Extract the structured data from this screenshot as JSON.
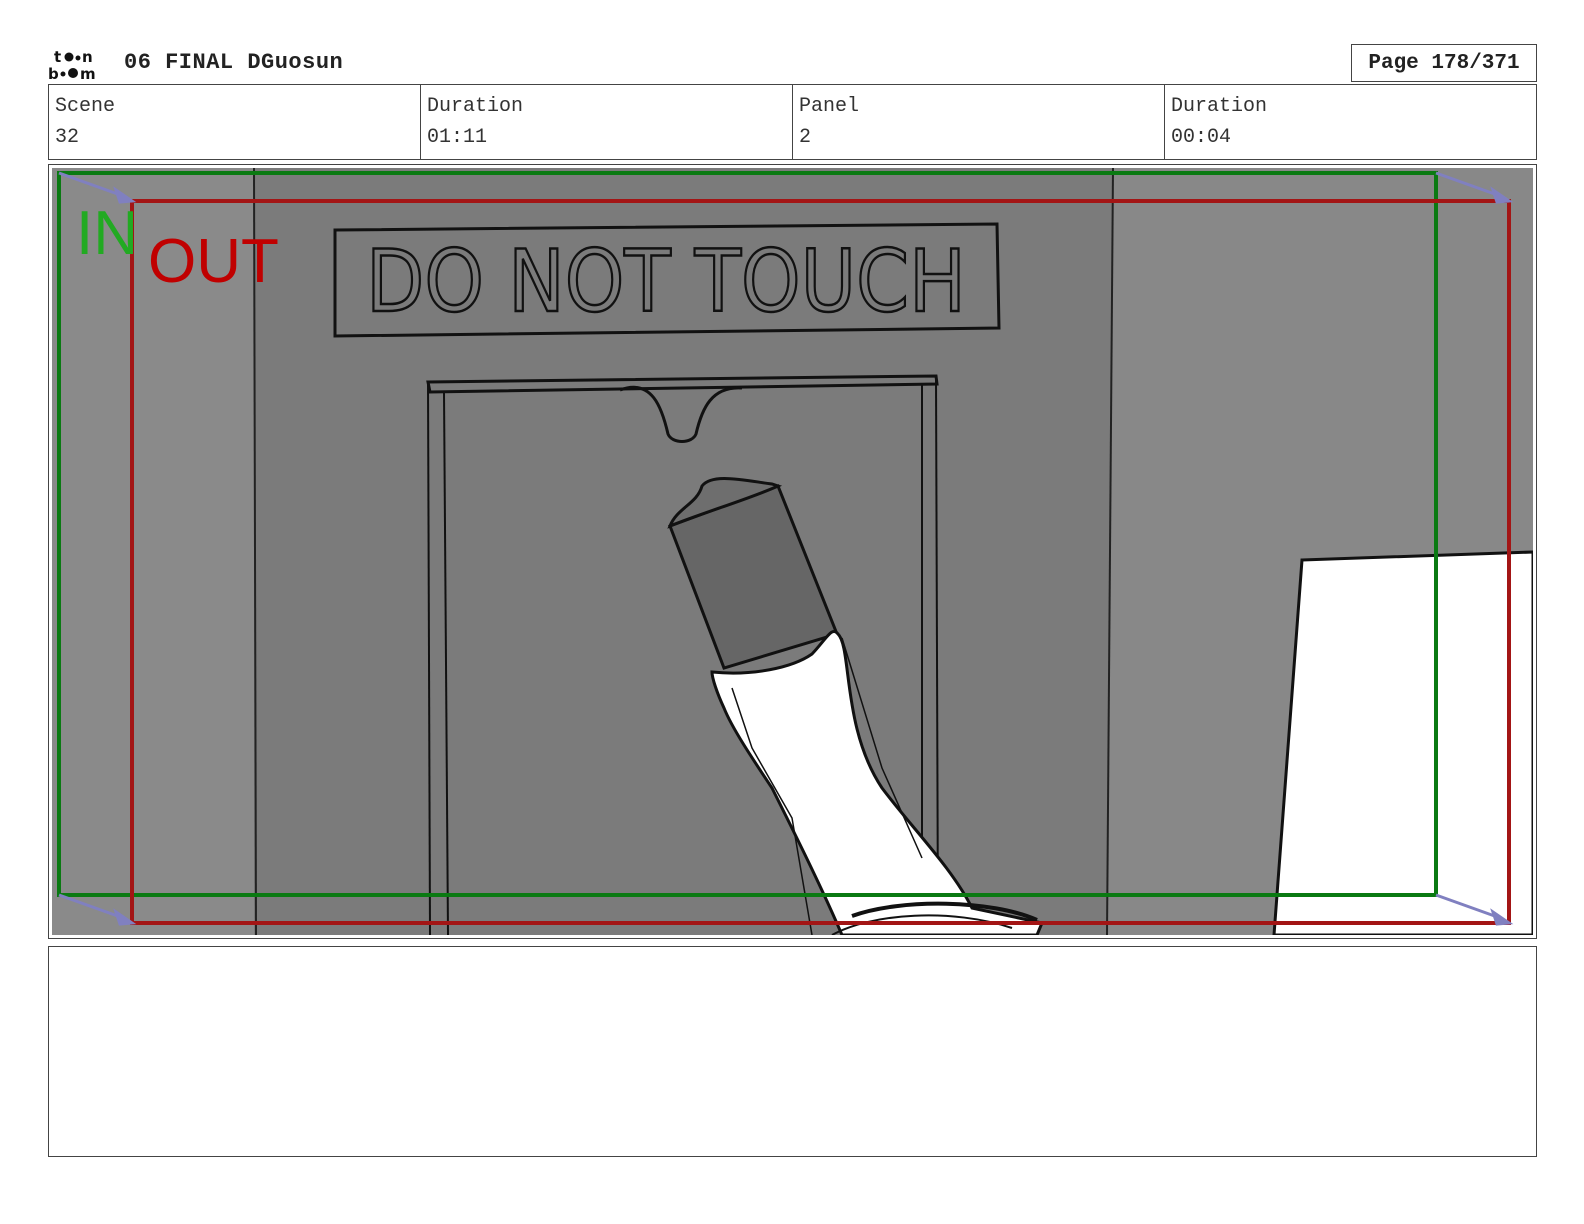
{
  "header": {
    "logo_text": "toon boom",
    "project_title": "06 FINAL DGuosun",
    "page_label": "Page 178/371"
  },
  "info": [
    {
      "label": "Scene",
      "value": "32"
    },
    {
      "label": "Duration",
      "value": "01:11"
    },
    {
      "label": "Panel",
      "value": "2"
    },
    {
      "label": "Duration",
      "value": "00:04"
    }
  ],
  "panel": {
    "sign_text": "DO NOT TOUCH",
    "in_label": "IN",
    "out_label": "OUT",
    "colors": {
      "in_frame": "#0a7a12",
      "out_frame": "#a31515",
      "in_text": "#22aa22",
      "out_text": "#c00000",
      "arrow": "#8080c0"
    }
  },
  "notes": {
    "text": ""
  }
}
